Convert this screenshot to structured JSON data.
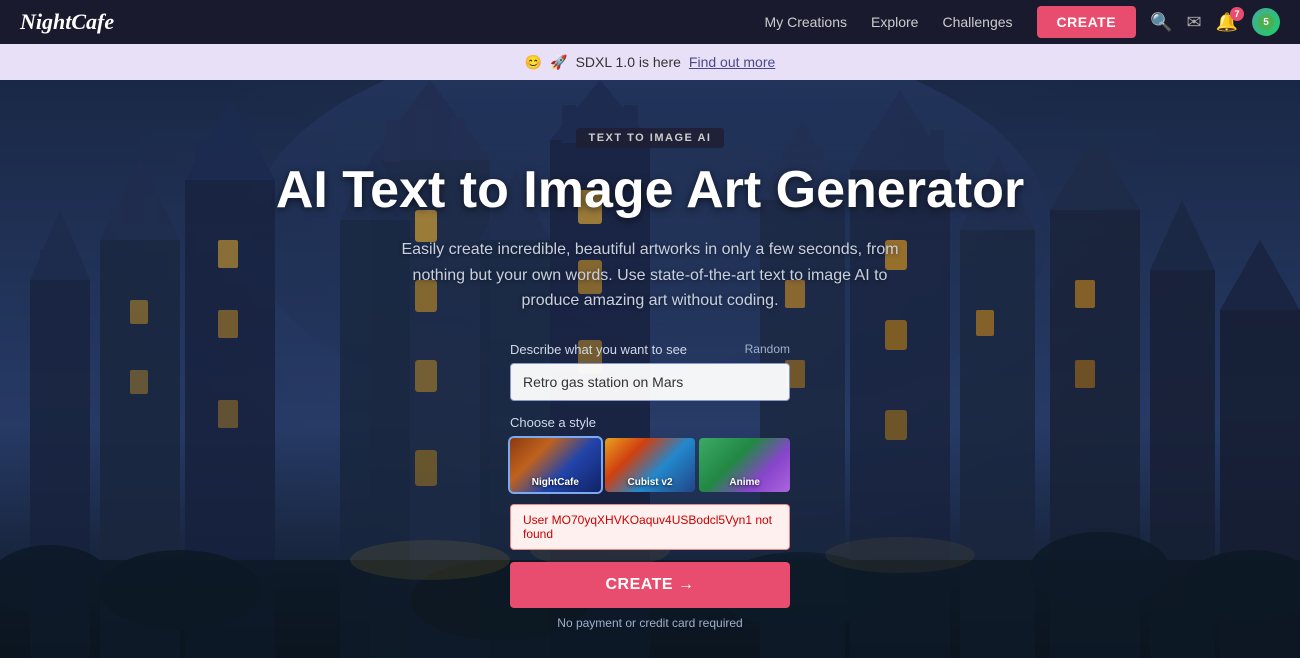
{
  "logo": {
    "text": "NightCafe"
  },
  "navbar": {
    "links": [
      {
        "label": "My Creations",
        "name": "my-creations-link"
      },
      {
        "label": "Explore",
        "name": "explore-link"
      },
      {
        "label": "Challenges",
        "name": "challenges-link"
      }
    ],
    "create_button": "CREATE",
    "icons": {
      "search": "🔍",
      "mail": "✉",
      "bell": "🔔",
      "bell_badge": "7",
      "profile_badge": "5"
    }
  },
  "announcement": {
    "emoji1": "😊",
    "emoji2": "🚀",
    "text": "SDXL 1.0 is here",
    "link": "Find out more"
  },
  "hero": {
    "tag": "TEXT TO IMAGE AI",
    "title": "AI Text to Image Art Generator",
    "subtitle": "Easily create incredible, beautiful artworks in only a few seconds, from nothing but your own words. Use state-of-the-art text to image AI to produce amazing art without coding.",
    "form": {
      "describe_label": "Describe what you want to see",
      "random_label": "Random",
      "input_value": "Retro gas station on Mars",
      "input_placeholder": "Retro gas station on Mars",
      "style_label": "Choose a style",
      "styles": [
        {
          "label": "NightCafe",
          "name": "nightcafe",
          "selected": true
        },
        {
          "label": "Cubist v2",
          "name": "cubist"
        },
        {
          "label": "Anime",
          "name": "anime"
        }
      ],
      "error_text": "User MO70yqXHVKOaquv4USBodcl5Vyn1 not found",
      "create_button": "CREATE →",
      "no_payment": "No payment or credit card required"
    }
  }
}
